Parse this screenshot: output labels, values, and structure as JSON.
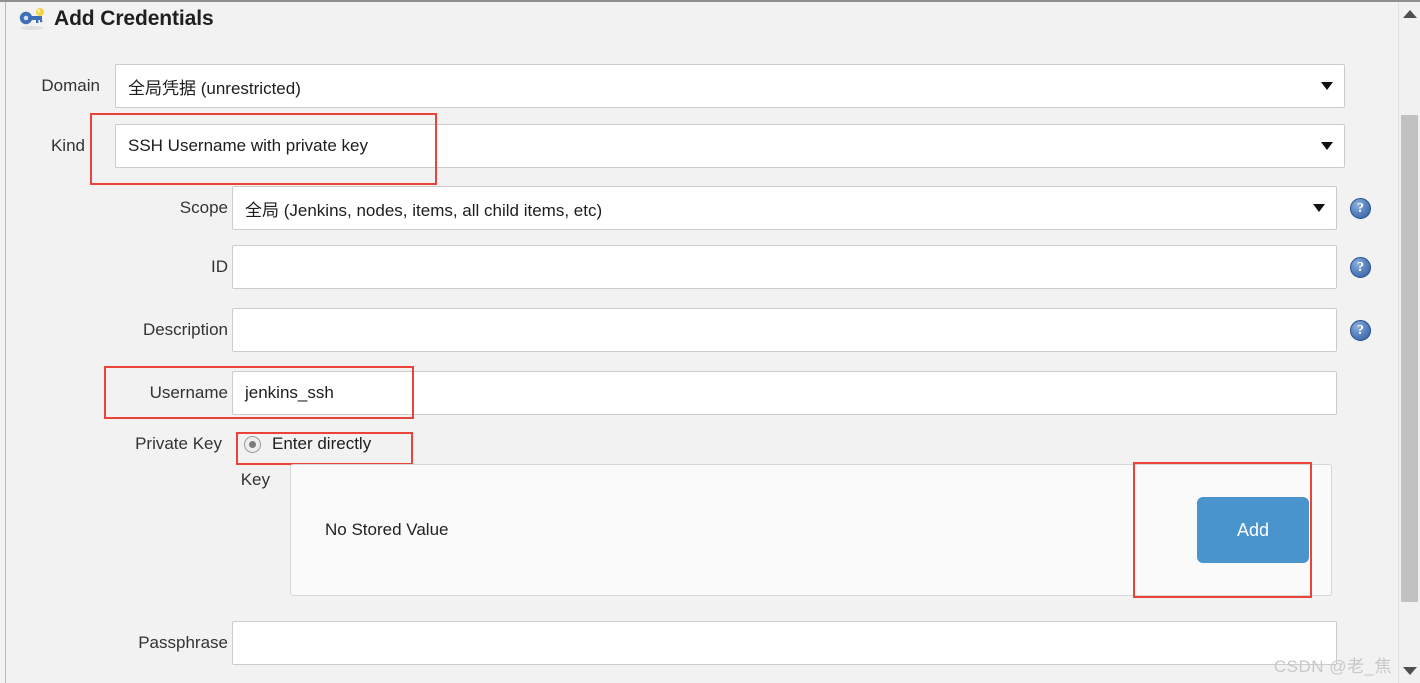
{
  "header": {
    "title": "Add Credentials",
    "icon": "key-icon"
  },
  "form": {
    "domain": {
      "label": "Domain",
      "value": "全局凭据 (unrestricted)"
    },
    "kind": {
      "label": "Kind",
      "value": "SSH Username with private key"
    },
    "scope": {
      "label": "Scope",
      "value": "全局 (Jenkins, nodes, items, all child items, etc)",
      "help": "?"
    },
    "id": {
      "label": "ID",
      "value": "",
      "help": "?"
    },
    "description": {
      "label": "Description",
      "value": "",
      "help": "?"
    },
    "username": {
      "label": "Username",
      "value": "jenkins_ssh"
    },
    "private_key": {
      "label": "Private Key",
      "option_label": "Enter directly",
      "key_label": "Key",
      "key_placeholder_text": "No Stored Value",
      "add_button": "Add"
    },
    "passphrase": {
      "label": "Passphrase",
      "value": ""
    }
  },
  "colors": {
    "annotation": "#e8443a",
    "button": "#4a94ce",
    "page_bg": "#f2f2f2",
    "help_icon": "#2f5b9e"
  },
  "watermark": "CSDN @老_焦"
}
